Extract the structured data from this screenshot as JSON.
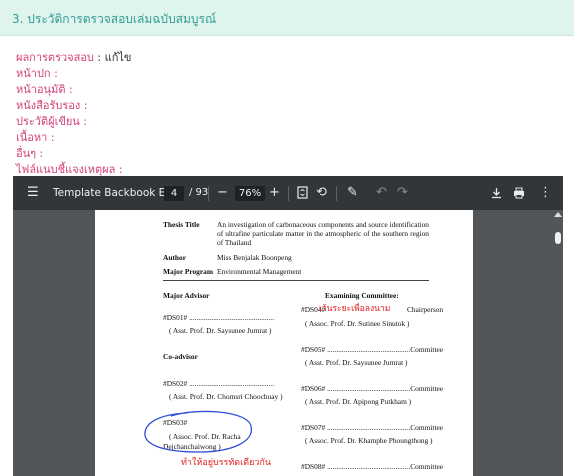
{
  "section": {
    "title": "3. ประวัติการตรวจสอบเล่มฉบับสมบูรณ์"
  },
  "review": {
    "result_label": "ผลการตรวจสอบ",
    "result_value": ": แก้ไข",
    "fields": [
      "หน้าปก  :",
      "หน้าอนุมัติ  :",
      "หนังสือรับรอง  :",
      "ประวัติผู้เขียน  :",
      "เนื้อหา  :",
      "อื่นๆ  :",
      "ไฟล์แนบชี้แจงเหตุผล  :"
    ]
  },
  "viewer": {
    "doc_title": "Template Backbook Eng",
    "current_page": "4",
    "page_total": "/ 93",
    "zoom": "76%",
    "icons": {
      "menu": "menu-icon",
      "zoom_out": "minus-icon",
      "zoom_in": "plus-icon",
      "fit": "fit-page-icon",
      "rotate": "rotate-icon",
      "annotate": "pen-icon",
      "undo": "undo-icon",
      "redo": "redo-icon",
      "download": "download-icon",
      "print": "print-icon",
      "more": "more-vert-icon"
    }
  },
  "doc": {
    "thesis_title_label": "Thesis Title",
    "thesis_title_text": "An investigation of carbonaceous components and source identification of ultrafine particulate matter in the atmospheric of the southern region of Thailand",
    "author_label": "Author",
    "author_value": "Miss Benjalak Boonpeng",
    "program_label": "Major Program",
    "program_value": "Environmental Management",
    "major_advisor_heading": "Major Advisor",
    "committee_heading": "Examining Committee:",
    "advisors": [
      {
        "line": "#DS01# ..............................................",
        "name": "( Asst. Prof. Dr. Saysunee Jumrat )"
      }
    ],
    "co_advisor_heading": "Co-advisor",
    "co_advisors": [
      {
        "line": "#DS02# ..............................................",
        "name": "( Asst. Prof. Dr. Chomsri Choochuay )"
      },
      {
        "line": "#DS03#",
        "name": "( Assoc. Prof. Dr. Racha",
        "name2": "Dejchanchaiwong )"
      }
    ],
    "committee": [
      {
        "line_start": "#DS04#",
        "line_end": "Chairperson",
        "name": "( Assoc. Prof. Dr. Sutinee Sinutok )"
      },
      {
        "line": "#DS05# .............................................Committee",
        "name": "( Asst. Prof. Dr. Saysunee Jumrat )"
      },
      {
        "line": "#DS06# .............................................Committee",
        "name": "( Asst. Prof. Dr. Apipong Putkham )"
      },
      {
        "line": "#DS07# .............................................Committee",
        "name": "( Assoc. Prof. Dr. Khamphe Phoungthong )"
      },
      {
        "line": "#DS08# .............................................Committee"
      }
    ]
  },
  "annotations": {
    "spacing_note": "เว้นระยะเพื่อลงนาม",
    "same_line_note": "ทำให้อยู่บรรทัดเดียวกัน",
    "ink_color": "#e0201c",
    "circle_color": "#2f4fd6"
  },
  "colors": {
    "header_bg": "#dff4ec",
    "header_text": "#2f9c95",
    "label_pink": "#d23f7a",
    "toolbar_bg": "#323639",
    "viewer_bg": "#525659"
  }
}
